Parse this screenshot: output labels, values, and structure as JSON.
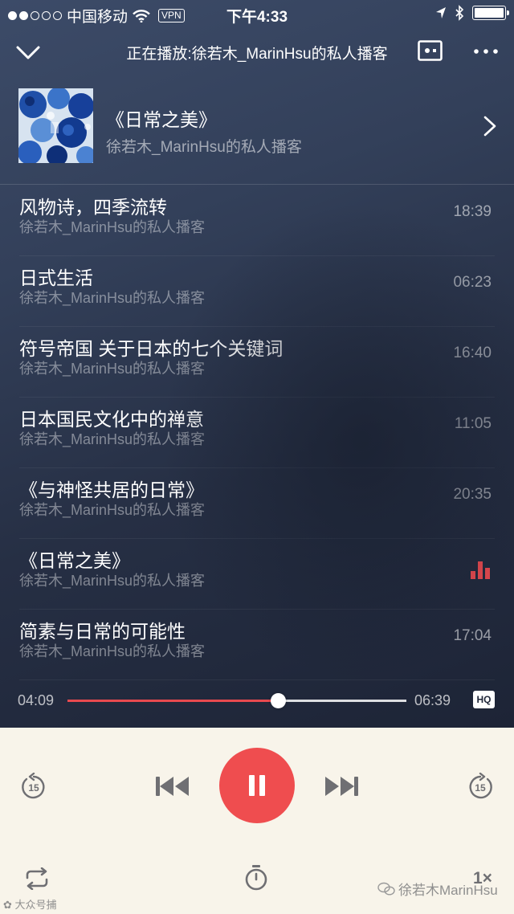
{
  "status_bar": {
    "carrier": "中国移动",
    "vpn": "VPN",
    "time": "下午4:33",
    "signal_filled": 2,
    "signal_total": 5,
    "battery_level": 1.0
  },
  "header": {
    "title": "正在播放:徐若木_MarinHsu的私人播客",
    "back_icon": "chevron-down-icon",
    "screen_icon": "screen-cast-icon",
    "more_icon": "more-dots-icon"
  },
  "album": {
    "name": "《日常之美》",
    "author": "徐若木_MarinHsu的私人播客"
  },
  "episodes": [
    {
      "title": "风物诗，四季流转",
      "author": "徐若木_MarinHsu的私人播客",
      "duration": "18:39",
      "playing": false
    },
    {
      "title": "日式生活",
      "author": "徐若木_MarinHsu的私人播客",
      "duration": "06:23",
      "playing": false
    },
    {
      "title": "符号帝国  关于日本的七个关键词",
      "author": "徐若木_MarinHsu的私人播客",
      "duration": "16:40",
      "playing": false
    },
    {
      "title": "日本国民文化中的禅意",
      "author": "徐若木_MarinHsu的私人播客",
      "duration": "11:05",
      "playing": false
    },
    {
      "title": "《与神怪共居的日常》",
      "author": "徐若木_MarinHsu的私人播客",
      "duration": "20:35",
      "playing": false
    },
    {
      "title": "《日常之美》",
      "author": "徐若木_MarinHsu的私人播客",
      "duration": "",
      "playing": true
    },
    {
      "title": "简素与日常的可能性",
      "author": "徐若木_MarinHsu的私人播客",
      "duration": "17:04",
      "playing": false
    }
  ],
  "player": {
    "current_time": "04:09",
    "total_time": "06:39",
    "progress_fraction": 0.62,
    "quality_badge": "HQ",
    "speed": "1×",
    "rewind_seconds": "15",
    "forward_seconds": "15"
  },
  "colors": {
    "accent": "#e84a4f",
    "play_button": "#ef4d4f",
    "panel_bg": "#f8f4ea",
    "icon_gray": "#6f6f73"
  },
  "watermarks": {
    "left": "大众号捕",
    "right": "徐若木MarinHsu"
  }
}
